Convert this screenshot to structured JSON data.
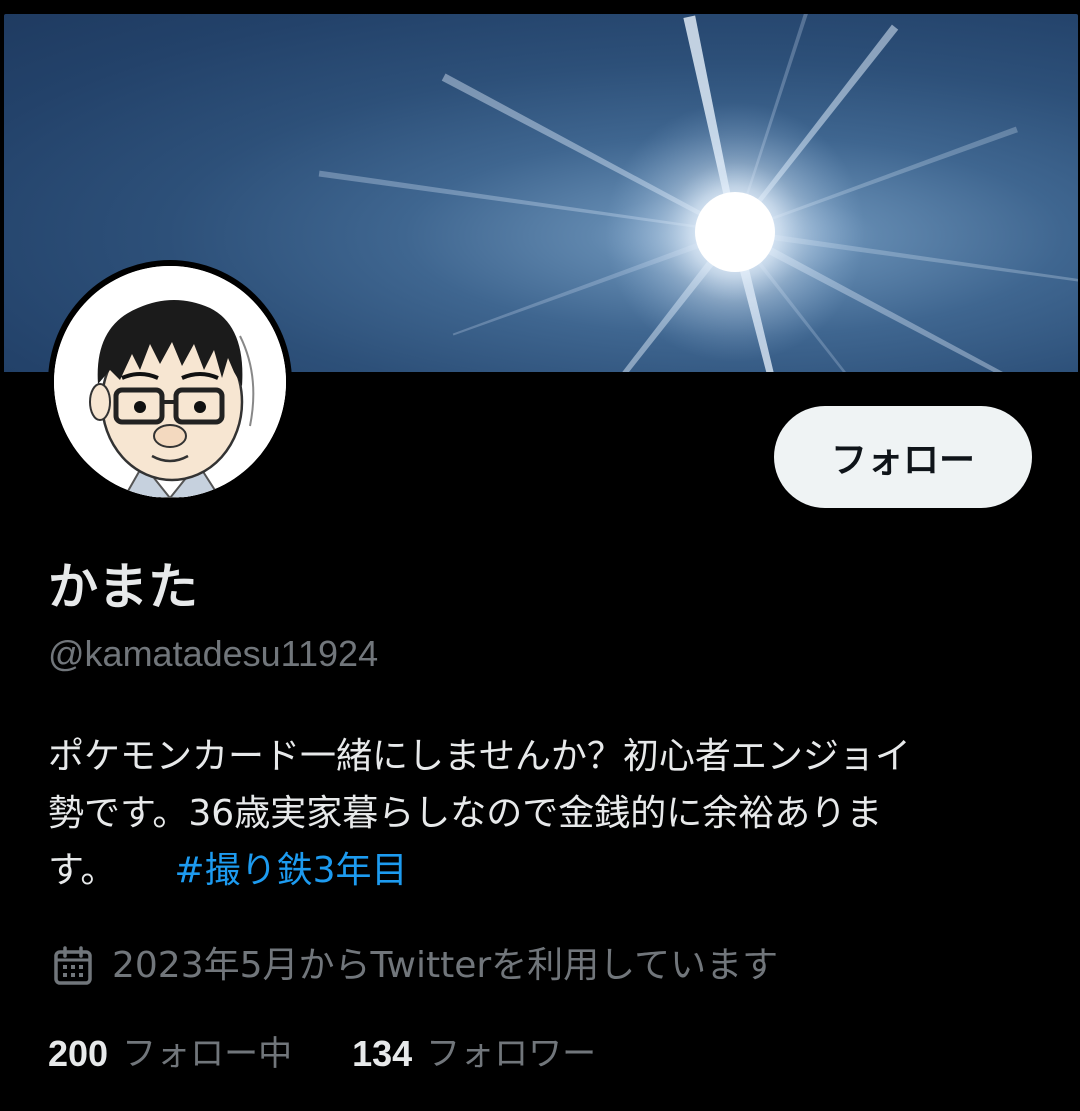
{
  "profile": {
    "display_name": "かまた",
    "handle": "@kamatadesu11924",
    "bio_line1": "ポケモンカード一緒にしませんか？初心者エンジョイ",
    "bio_line2": "勢です。36歳実家暮らしなので金銭的に余裕ありま",
    "bio_line3": "す。",
    "hashtag": "#撮り鉄3年目",
    "joined": "2023年5月からTwitterを利用しています",
    "following_count": "200",
    "following_label": "フォロー中",
    "followers_count": "134",
    "followers_label": "フォロワー"
  },
  "actions": {
    "follow_label": "フォロー"
  },
  "icons": {
    "joined": "calendar-icon"
  },
  "colors": {
    "background": "#000000",
    "text_primary": "#e7e9ea",
    "text_secondary": "#71767b",
    "link": "#1d9bf0",
    "follow_button_bg": "#eff3f4",
    "follow_button_text": "#0f1419"
  }
}
